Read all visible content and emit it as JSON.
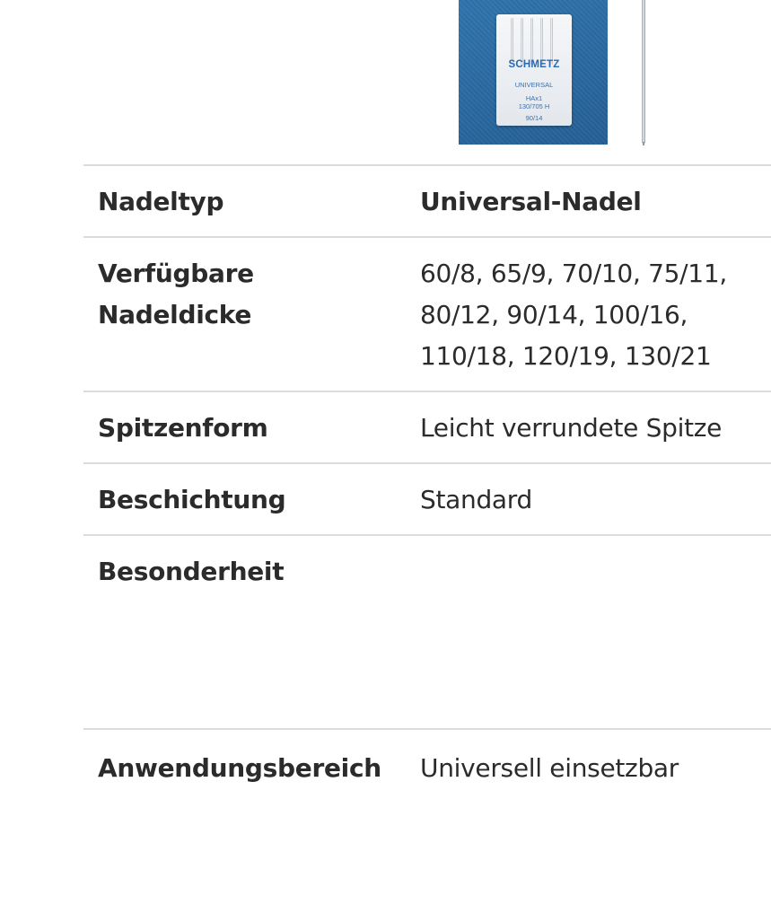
{
  "product_image": {
    "brand": "SCHMETZ",
    "line1": "UNIVERSAL",
    "line2": "HAx1",
    "line3": "130/705 H",
    "line4": "90/14",
    "background_color": "#2a6aa2"
  },
  "specs": [
    {
      "label": "Nadeltyp",
      "value": "Universal-Nadel"
    },
    {
      "label": "Verfügbare\nNadeldicke",
      "value": "60/8, 65/9, 70/10, 75/11,\n80/12, 90/14, 100/16,\n110/18, 120/19, 130/21"
    },
    {
      "label": "Spitzenform",
      "value": "Leicht verrundete Spitze"
    },
    {
      "label": "Beschichtung",
      "value": "Standard"
    },
    {
      "label": "Besonderheit",
      "value": ""
    },
    {
      "label": "Anwendungsbereich",
      "value": "Universell einsetzbar"
    }
  ],
  "colors": {
    "text": "#2b2b2b",
    "divider": "#dcdcdc"
  }
}
